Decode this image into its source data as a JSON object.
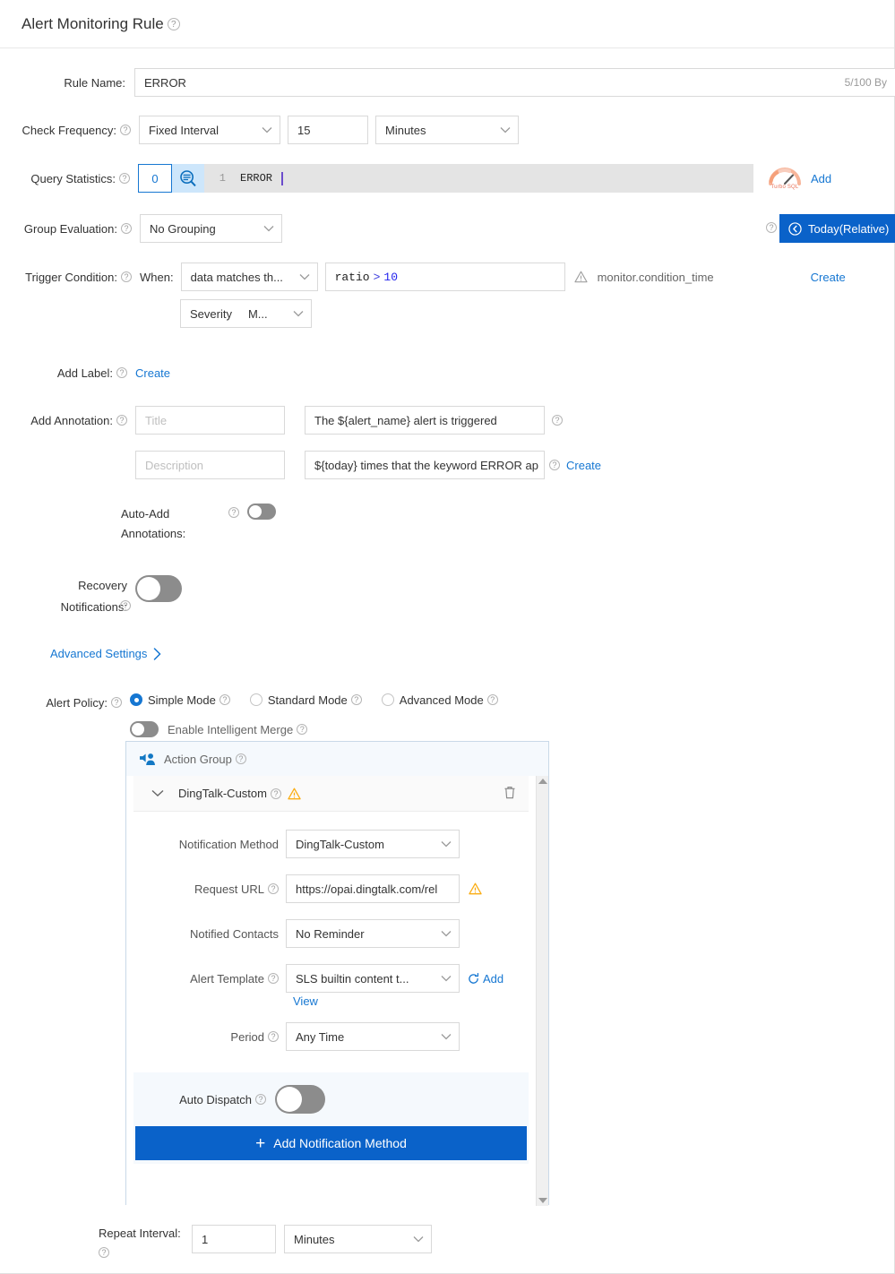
{
  "header": {
    "title": "Alert Monitoring Rule",
    "help_icon": "help-circle-icon"
  },
  "rule_name": {
    "label": "Rule Name:",
    "value": "ERROR",
    "counter": "5/100 By"
  },
  "check_frequency": {
    "label": "Check Frequency:",
    "mode": "Fixed Interval",
    "interval": "15",
    "unit": "Minutes"
  },
  "query_statistics": {
    "label": "Query Statistics:",
    "index": "0",
    "search_icon": "query-search-icon",
    "line_number": "1",
    "query": "ERROR",
    "turbo_label": "Turbo SQL",
    "turbo_icon": "turbo-sql-gauge-icon",
    "add_link": "Add"
  },
  "group_evaluation": {
    "label": "Group Evaluation:",
    "value": "No Grouping",
    "time_range_icon": "clock-back-icon",
    "time_range": "Today(Relative)"
  },
  "trigger_condition": {
    "label": "Trigger Condition:",
    "when_label": "When:",
    "match_type": "data matches th...",
    "expression_prefix": "ratio",
    "expression_op": ">",
    "expression_value": "10",
    "warn_icon": "warning-triangle-icon",
    "hint": "monitor.condition_time",
    "create_link": "Create",
    "severity_label": "Severity",
    "severity_value": "M..."
  },
  "add_label": {
    "label": "Add Label:",
    "create_link": "Create"
  },
  "add_annotation": {
    "label": "Add Annotation:",
    "title_placeholder": "Title",
    "title_value": "",
    "content_value": "The ${alert_name} alert is triggered",
    "description_placeholder": "Description",
    "description_value": "",
    "description_content": "${today} times that the keyword ERROR ap",
    "create_link": "Create"
  },
  "auto_add_annotations": {
    "label_line1": "Auto-Add",
    "label_line2": "Annotations:",
    "enabled": false
  },
  "recovery_notifications": {
    "label_line1": "Recovery",
    "label_line2": "Notifications:",
    "enabled": false
  },
  "advanced_settings": {
    "label": "Advanced Settings",
    "chevron": "chevron-right-icon"
  },
  "alert_policy": {
    "label": "Alert Policy:",
    "modes": [
      {
        "label": "Simple Mode",
        "selected": true
      },
      {
        "label": "Standard Mode",
        "selected": false
      },
      {
        "label": "Advanced Mode",
        "selected": false
      }
    ],
    "intelligent_merge_label": "Enable Intelligent Merge",
    "intelligent_merge_enabled": false
  },
  "action_group": {
    "title": "Action Group",
    "icon": "megaphone-person-icon",
    "method": {
      "name": "DingTalk-Custom",
      "collapse_icon": "chevron-down-icon",
      "warn_icon": "warning-triangle-icon",
      "delete_icon": "trash-icon",
      "fields": [
        {
          "label": "Notification Method",
          "value": "DingTalk-Custom",
          "type": "select",
          "help": false
        },
        {
          "label": "Request URL",
          "value": "https://opai.dingtalk.com/rel",
          "type": "input",
          "help": true,
          "warn": true
        },
        {
          "label": "Notified Contacts",
          "value": "No Reminder",
          "type": "select",
          "help": false
        },
        {
          "label": "Alert Template",
          "value": "SLS builtin content t...",
          "type": "select",
          "help": true,
          "refresh_label": "Add",
          "view_link": "View"
        },
        {
          "label": "Period",
          "value": "Any Time",
          "type": "select",
          "help": true
        }
      ]
    },
    "auto_dispatch_label": "Auto Dispatch",
    "auto_dispatch_enabled": false,
    "add_button": "Add Notification Method",
    "add_button_icon": "plus-icon",
    "scroll_up_icon": "scroll-up-arrow-icon",
    "scroll_down_icon": "scroll-down-arrow-icon"
  },
  "repeat_interval": {
    "label": "Repeat Interval:",
    "value": "1",
    "unit": "Minutes"
  },
  "colors": {
    "accent": "#1677d2",
    "primary_button": "#0a62c9",
    "warning": "#faad14",
    "toggle_off": "#8c8c8c",
    "panel_border": "#c9d9e8",
    "panel_header_bg": "#f5f9fd"
  }
}
